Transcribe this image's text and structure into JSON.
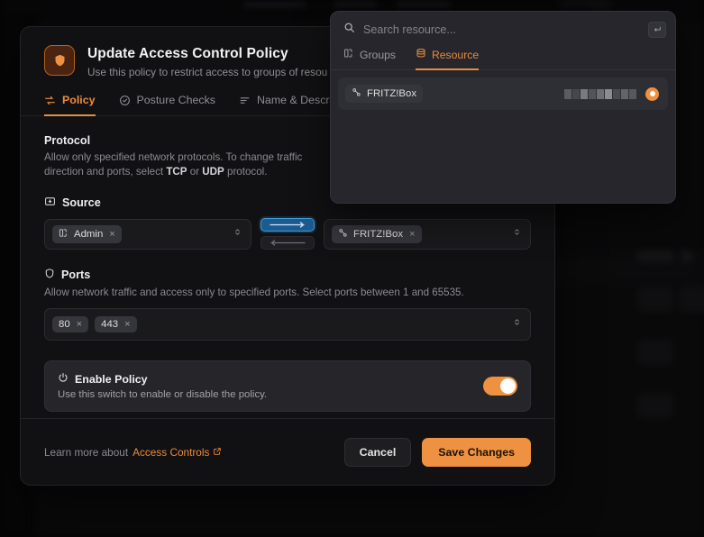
{
  "modal": {
    "icon": "shield-icon",
    "title": "Update Access Control Policy",
    "subtitle": "Use this policy to restrict access to groups of resou",
    "tabs": [
      {
        "label": "Policy",
        "icon": "arrows-exchange-icon",
        "active": true
      },
      {
        "label": "Posture Checks",
        "icon": "shield-check-icon",
        "active": false
      },
      {
        "label": "Name & Description",
        "icon": "list-icon",
        "active": false
      }
    ],
    "protocol": {
      "title": "Protocol",
      "desc_1": "Allow only specified network protocols. To change traffic direction and ports, select ",
      "tcp": "TCP",
      "desc_2": " or ",
      "udp": "UDP",
      "desc_3": " protocol."
    },
    "source": {
      "label": "Source",
      "icon": "inbox-in-icon",
      "chip": {
        "label": "Admin",
        "icon": "group-icon",
        "remove": "×"
      }
    },
    "direction": {
      "forward_active": true,
      "backward_active": false
    },
    "destination": {
      "chip": {
        "label": "FRITZ!Box",
        "icon": "resource-icon",
        "remove": "×"
      }
    },
    "ports": {
      "title": "Ports",
      "icon": "shield-outline-icon",
      "desc": "Allow network traffic and access only to specified ports. Select ports between 1 and 65535.",
      "chips": [
        {
          "label": "80",
          "remove": "×"
        },
        {
          "label": "443",
          "remove": "×"
        }
      ]
    },
    "enable": {
      "title": "Enable Policy",
      "icon": "power-icon",
      "desc": "Use this switch to enable or disable the policy.",
      "switch_on": true
    },
    "footer": {
      "learn_prefix": "Learn more about",
      "learn_link": "Access Controls",
      "cancel_label": "Cancel",
      "save_label": "Save Changes"
    }
  },
  "dropdown": {
    "search": {
      "value": "",
      "placeholder": "Search resource...",
      "icon": "search-icon",
      "enter_key_icon": "enter-key-icon"
    },
    "tabs": [
      {
        "label": "Groups",
        "icon": "group-icon",
        "active": false
      },
      {
        "label": "Resource",
        "icon": "database-icon",
        "active": true
      }
    ],
    "results": [
      {
        "chip_label": "FRITZ!Box",
        "chip_icon": "resource-icon",
        "redacted": true,
        "selected": true
      }
    ]
  },
  "colors": {
    "accent": "#ee9140",
    "accent_text": "#eb8c3a",
    "direction_active": "#3e9ddd",
    "modal_bg": "#111113",
    "dropdown_bg": "#26262c"
  }
}
